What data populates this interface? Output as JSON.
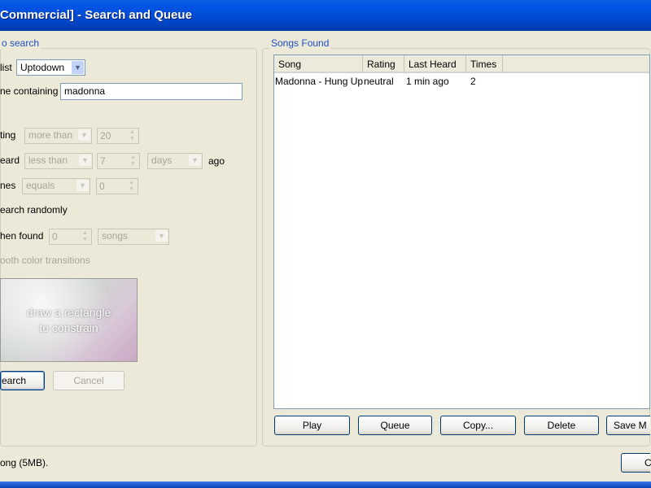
{
  "window": {
    "title": "Commercial] - Search and Queue"
  },
  "search_panel": {
    "legend": "o search",
    "playlist_label": "list",
    "playlist_value": "Uptodown",
    "name_label": "ne containing",
    "name_value": "madonna",
    "rating_label": "ting",
    "rating_op": "more than",
    "rating_value": "20",
    "heard_label": "eard",
    "heard_op": "less than",
    "heard_value": "7",
    "heard_unit": "days",
    "heard_suffix": "ago",
    "times_label": "nes",
    "times_op": "equals",
    "times_value": "0",
    "random_label": "earch randomly",
    "stop_label": "hen found",
    "stop_value": "0",
    "stop_unit": "songs",
    "smooth_label": "ooth color transitions",
    "color_hint_1": "draw a rectangle",
    "color_hint_2": "to constrain",
    "search_button": "earch",
    "cancel_button": "Cancel"
  },
  "songs_panel": {
    "legend": "Songs Found",
    "columns": [
      "Song",
      "Rating",
      "Last Heard",
      "Times"
    ],
    "rows": [
      {
        "song": "Madonna - Hung Up",
        "rating": "neutral",
        "last_heard": "1 min ago",
        "times": "2"
      }
    ],
    "buttons": {
      "play": "Play",
      "queue": "Queue",
      "copy": "Copy...",
      "delete": "Delete",
      "save": "Save M"
    }
  },
  "status": {
    "text": "ong (5MB).",
    "close_button": "C"
  }
}
